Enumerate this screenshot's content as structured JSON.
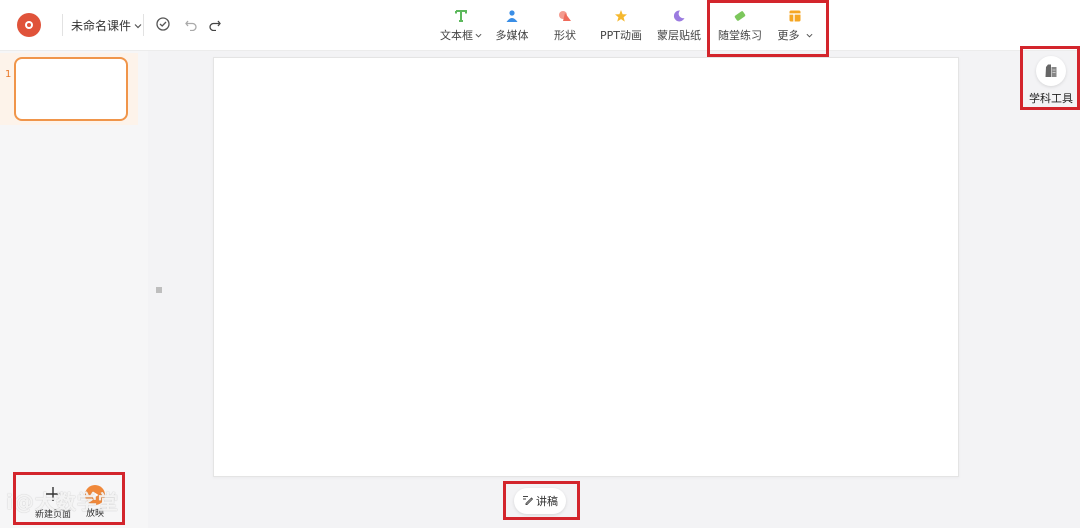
{
  "app": {
    "document_title": "未命名课件"
  },
  "toolbar": {
    "tools": [
      {
        "label": "文本框",
        "has_dropdown": true,
        "icon": "text-icon",
        "color": "#5cb85c"
      },
      {
        "label": "多媒体",
        "has_dropdown": false,
        "icon": "multimedia-icon",
        "color": "#3a8ee6"
      },
      {
        "label": "形状",
        "has_dropdown": false,
        "icon": "shape-icon",
        "color": "#ef6b5b"
      },
      {
        "label": "PPT动画",
        "has_dropdown": false,
        "icon": "animation-icon",
        "color": "#f5b82e"
      },
      {
        "label": "蒙层贴纸",
        "has_dropdown": false,
        "icon": "sticker-icon",
        "color": "#9b7be0"
      },
      {
        "label": "随堂练习",
        "has_dropdown": false,
        "icon": "exercise-icon",
        "color": "#7cc75c"
      },
      {
        "label": "更多",
        "has_dropdown": true,
        "icon": "more-icon",
        "color": "#f5a623"
      }
    ]
  },
  "slides": {
    "items": [
      {
        "number": "1"
      }
    ]
  },
  "left_bottom": {
    "new_page_label": "新建页面",
    "play_label": "放映"
  },
  "notes": {
    "label": "讲稿"
  },
  "right_panel": {
    "subject_tools_label": "学科工具"
  },
  "watermark": {
    "text": "i@大数学堂"
  },
  "colors": {
    "accent": "#f0883a",
    "highlight_box": "#d3252c"
  }
}
